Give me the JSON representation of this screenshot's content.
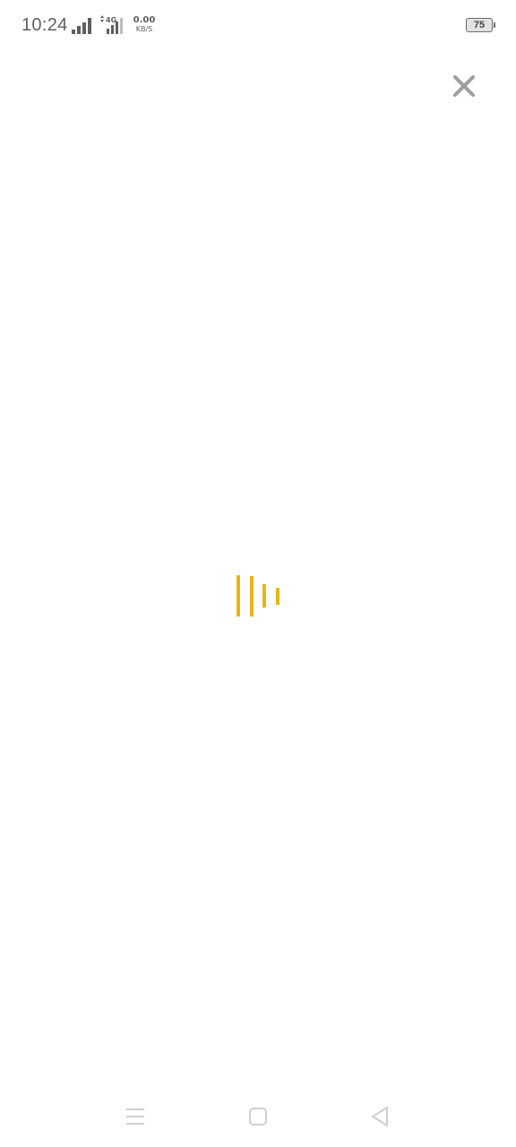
{
  "status_bar": {
    "time": "10:24",
    "network_type": "4G",
    "net_speed_value": "0.00",
    "net_speed_unit": "KB/S",
    "battery_level": "75",
    "icons": [
      "signal-strength-icon",
      "mobile-data-4g-icon",
      "battery-icon"
    ]
  },
  "overlay": {
    "close_icon": "close-icon",
    "close_color": "#9e9e9e"
  },
  "loader": {
    "icon": "loading-bars-icon",
    "color": "#e8b512",
    "bar_count": 4
  },
  "nav_bar": {
    "icons": [
      "menu-icon",
      "home-icon",
      "back-icon"
    ],
    "color": "#cfcfcf"
  }
}
